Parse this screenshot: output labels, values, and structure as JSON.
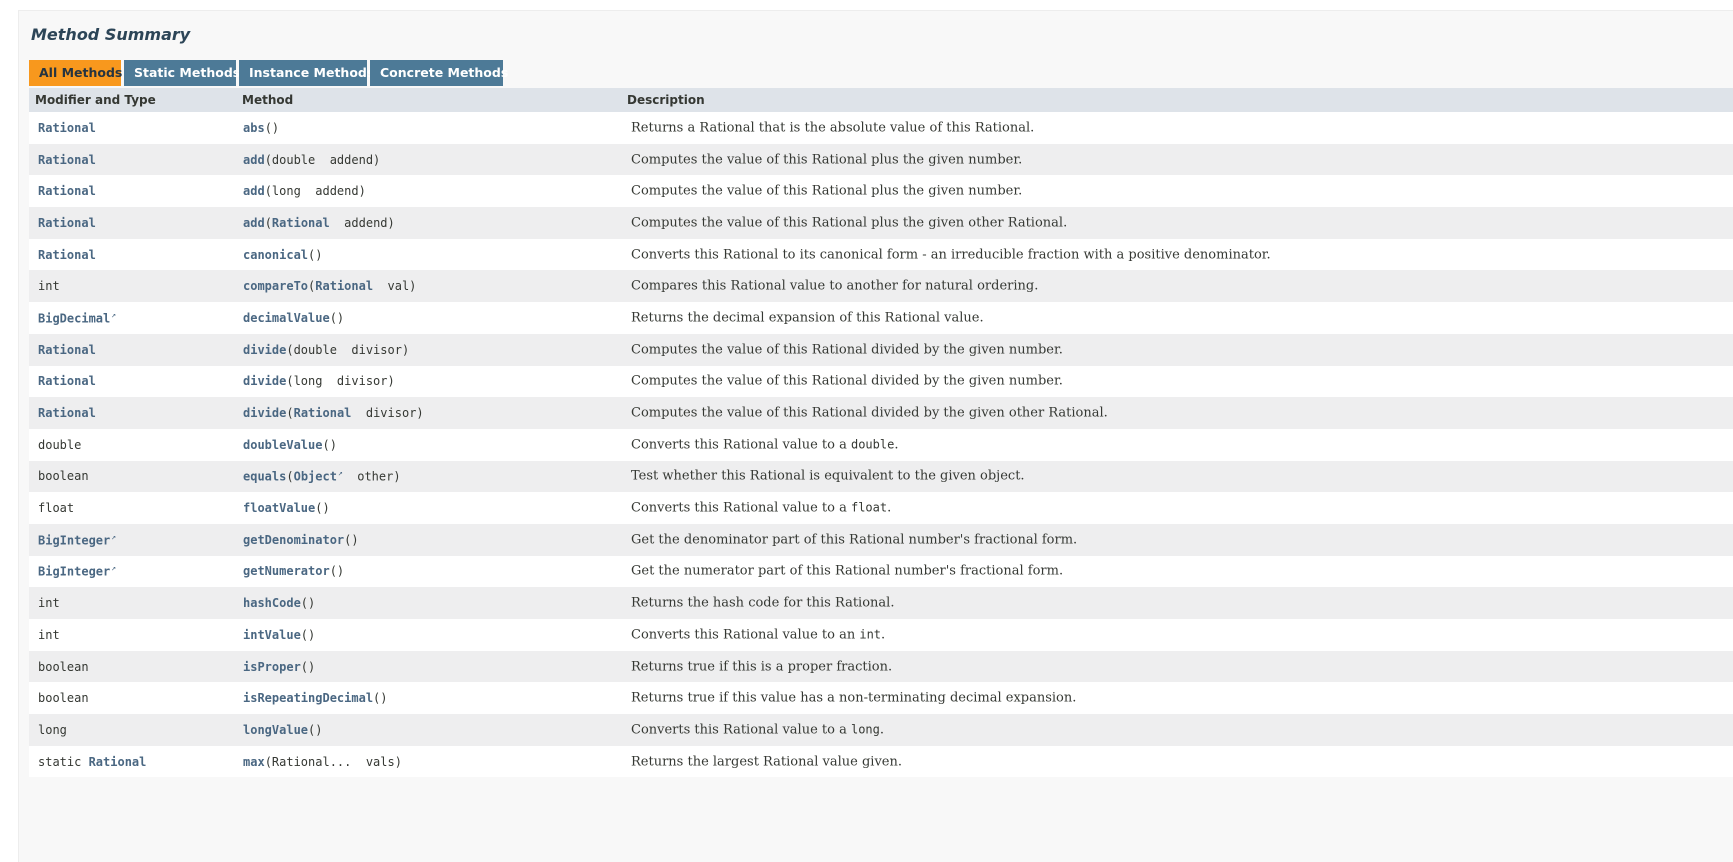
{
  "page": {
    "title": "Method Summary",
    "tabs": [
      "All Methods",
      "Static Methods",
      "Instance Methods",
      "Concrete Methods"
    ],
    "headers": {
      "modifier": "Modifier and Type",
      "method": "Method",
      "description": "Description"
    },
    "rows": [
      {
        "mod_prefix": "",
        "type": "Rational",
        "type_link": true,
        "type_ext": false,
        "name": "abs",
        "params": "()",
        "desc": "Returns a Rational that is the absolute value of this Rational."
      },
      {
        "mod_prefix": "",
        "type": "Rational",
        "type_link": true,
        "type_ext": false,
        "name": "add",
        "params": "(double  addend)",
        "desc": "Computes the value of this Rational plus the given number."
      },
      {
        "mod_prefix": "",
        "type": "Rational",
        "type_link": true,
        "type_ext": false,
        "name": "add",
        "params": "(long  addend)",
        "desc": "Computes the value of this Rational plus the given number."
      },
      {
        "mod_prefix": "",
        "type": "Rational",
        "type_link": true,
        "type_ext": false,
        "name": "add",
        "param_type": "Rational",
        "params_after": "  addend)",
        "desc": "Computes the value of this Rational plus the given other Rational."
      },
      {
        "mod_prefix": "",
        "type": "Rational",
        "type_link": true,
        "type_ext": false,
        "name": "canonical",
        "params": "()",
        "desc": "Converts this Rational to its canonical form - an irreducible fraction with a positive denominator."
      },
      {
        "mod_prefix": "",
        "type": "int",
        "type_link": false,
        "type_ext": false,
        "name": "compareTo",
        "param_type": "Rational",
        "params_after": "  val)",
        "desc": "Compares this Rational value to another for natural ordering."
      },
      {
        "mod_prefix": "",
        "type": "BigDecimal",
        "type_link": true,
        "type_ext": true,
        "name": "decimalValue",
        "params": "()",
        "desc": "Returns the decimal expansion of this Rational value."
      },
      {
        "mod_prefix": "",
        "type": "Rational",
        "type_link": true,
        "type_ext": false,
        "name": "divide",
        "params": "(double  divisor)",
        "desc": "Computes the value of this Rational divided by the given number."
      },
      {
        "mod_prefix": "",
        "type": "Rational",
        "type_link": true,
        "type_ext": false,
        "name": "divide",
        "params": "(long  divisor)",
        "desc": "Computes the value of this Rational divided by the given number."
      },
      {
        "mod_prefix": "",
        "type": "Rational",
        "type_link": true,
        "type_ext": false,
        "name": "divide",
        "param_type": "Rational",
        "params_after": "  divisor)",
        "desc": "Computes the value of this Rational divided by the given other Rational."
      },
      {
        "mod_prefix": "",
        "type": "double",
        "type_link": false,
        "type_ext": false,
        "name": "doubleValue",
        "params": "()",
        "desc": "Converts this Rational value to a ",
        "desc_code": "double",
        "desc_after": "."
      },
      {
        "mod_prefix": "",
        "type": "boolean",
        "type_link": false,
        "type_ext": false,
        "name": "equals",
        "param_type": "Object",
        "param_ext": true,
        "params_after": "  other)",
        "desc": "Test whether this Rational is equivalent to the given object."
      },
      {
        "mod_prefix": "",
        "type": "float",
        "type_link": false,
        "type_ext": false,
        "name": "floatValue",
        "params": "()",
        "desc": "Converts this Rational value to a ",
        "desc_code": "float",
        "desc_after": "."
      },
      {
        "mod_prefix": "",
        "type": "BigInteger",
        "type_link": true,
        "type_ext": true,
        "name": "getDenominator",
        "params": "()",
        "desc": "Get the denominator part of this Rational number's fractional form."
      },
      {
        "mod_prefix": "",
        "type": "BigInteger",
        "type_link": true,
        "type_ext": true,
        "name": "getNumerator",
        "params": "()",
        "desc": "Get the numerator part of this Rational number's fractional form."
      },
      {
        "mod_prefix": "",
        "type": "int",
        "type_link": false,
        "type_ext": false,
        "name": "hashCode",
        "params": "()",
        "desc": "Returns the hash code for this Rational."
      },
      {
        "mod_prefix": "",
        "type": "int",
        "type_link": false,
        "type_ext": false,
        "name": "intValue",
        "params": "()",
        "desc": "Converts this Rational value to an ",
        "desc_code": "int",
        "desc_after": "."
      },
      {
        "mod_prefix": "",
        "type": "boolean",
        "type_link": false,
        "type_ext": false,
        "name": "isProper",
        "params": "()",
        "desc": "Returns true if this is a proper fraction."
      },
      {
        "mod_prefix": "",
        "type": "boolean",
        "type_link": false,
        "type_ext": false,
        "name": "isRepeatingDecimal",
        "params": "()",
        "desc": "Returns true if this value has a non-terminating decimal expansion."
      },
      {
        "mod_prefix": "",
        "type": "long",
        "type_link": false,
        "type_ext": false,
        "name": "longValue",
        "params": "()",
        "desc": "Converts this Rational value to a ",
        "desc_code": "long",
        "desc_after": "."
      },
      {
        "mod_prefix": "static ",
        "type": "Rational",
        "type_link": true,
        "type_ext": false,
        "name": "max",
        "params": "(Rational...  vals)",
        "desc": "Returns the largest Rational value given."
      }
    ]
  },
  "colors": {
    "link": "#4a6782",
    "tab": "#4d7a97",
    "tab_active": "#f8981d",
    "header_bg": "#dee3e9",
    "row_alt": "#eeeeef"
  },
  "icons": {
    "external_link": "external-link-icon"
  }
}
